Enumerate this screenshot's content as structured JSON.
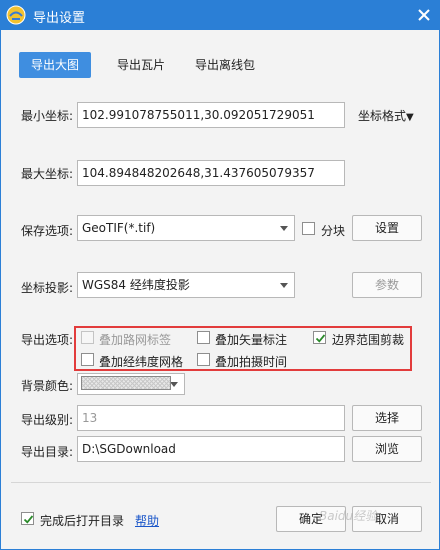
{
  "window": {
    "title": "导出设置"
  },
  "tabs": [
    {
      "label": "导出大图",
      "active": true
    },
    {
      "label": "导出瓦片",
      "active": false
    },
    {
      "label": "导出离线包",
      "active": false
    }
  ],
  "min_coord": {
    "label": "最小坐标:",
    "value": "102.991078755011,30.092051729051"
  },
  "coord_format": {
    "label": "坐标格式"
  },
  "max_coord": {
    "label": "最大坐标:",
    "value": "104.894848202648,31.437605079357"
  },
  "save_option": {
    "label": "保存选项:",
    "value": "GeoTIF(*.tif)",
    "tile_label": "分块",
    "tile_checked": false,
    "settings_label": "设置"
  },
  "projection": {
    "label": "坐标投影:",
    "value": "WGS84 经纬度投影",
    "params_label": "参数"
  },
  "export_options": {
    "label": "导出选项:",
    "items": [
      {
        "label": "叠加路网标签",
        "checked": false,
        "disabled": true
      },
      {
        "label": "叠加矢量标注",
        "checked": false,
        "disabled": false
      },
      {
        "label": "边界范围剪裁",
        "checked": true,
        "disabled": false
      },
      {
        "label": "叠加经纬度网格",
        "checked": false,
        "disabled": false
      },
      {
        "label": "叠加拍摄时间",
        "checked": false,
        "disabled": false
      }
    ]
  },
  "background_color": {
    "label": "背景颜色:"
  },
  "export_level": {
    "label": "导出级别:",
    "value": "13",
    "select_label": "选择"
  },
  "export_dir": {
    "label": "导出目录:",
    "value": "D:\\SGDownload",
    "browse_label": "浏览"
  },
  "footer": {
    "open_after_label": "完成后打开目录",
    "open_after_checked": true,
    "help_label": "帮助",
    "ok_label": "确定",
    "cancel_label": "取消",
    "watermark": "Baidu经验"
  },
  "colors": {
    "titlebar": "#2b7fd6",
    "active_tab": "#3f8ee0",
    "highlight_border": "#e23b3b",
    "link": "#1a56c9"
  }
}
